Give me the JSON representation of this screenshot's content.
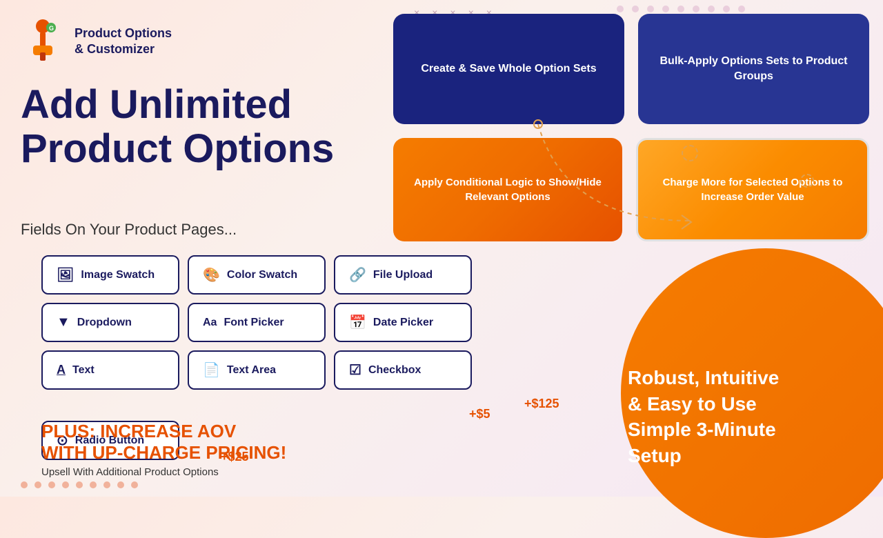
{
  "app": {
    "logo_line1": "Product Options",
    "logo_line2": "& Customizer"
  },
  "headline": {
    "line1": "Add Unlimited",
    "line2": "Product Options",
    "sub": "Fields On Your  Product Pages..."
  },
  "feature_cards": [
    {
      "id": "create-save",
      "text": "Create & Save Whole Option Sets",
      "style": "dark-blue"
    },
    {
      "id": "bulk-apply",
      "text": "Bulk-Apply Options Sets to Product Groups",
      "style": "navy"
    },
    {
      "id": "conditional",
      "text": "Apply Conditional Logic to Show/Hide Relevant Options",
      "style": "orange"
    },
    {
      "id": "charge-more",
      "text": "Charge More for Selected Options to Increase Order Value",
      "style": "outlined-orange"
    }
  ],
  "option_buttons": [
    {
      "id": "image-swatch",
      "icon": "🖼",
      "label": "Image Swatch"
    },
    {
      "id": "color-swatch",
      "icon": "🎨",
      "label": "Color Swatch"
    },
    {
      "id": "file-upload",
      "icon": "🔗",
      "label": "File Upload"
    },
    {
      "id": "dropdown",
      "icon": "▼",
      "label": "Dropdown"
    },
    {
      "id": "font-picker",
      "icon": "Aa",
      "label": "Font Picker"
    },
    {
      "id": "date-picker",
      "icon": "📅",
      "label": "Date Picker"
    },
    {
      "id": "text",
      "icon": "A",
      "label": "Text"
    },
    {
      "id": "text-area",
      "icon": "📄",
      "label": "Text Area"
    },
    {
      "id": "checkbox",
      "icon": "☑",
      "label": "Checkbox"
    },
    {
      "id": "radio-button",
      "icon": "⊙",
      "label": "Radio Button"
    }
  ],
  "aov": {
    "title_line1": "PLUS: INCREASE AOV",
    "title_line2": "WITH UP-CHARGE PRICING!",
    "subtitle": "Upsell With Additional Product Options"
  },
  "price_badges": [
    "+$5",
    "+$125",
    "+$25"
  ],
  "bottom_right": {
    "line1": "Robust, Intuitive",
    "line2": "& Easy to Use",
    "line3": "Simple 3-Minute",
    "line4": "Setup"
  },
  "crosses": [
    "×",
    "×",
    "×",
    "×",
    "×"
  ],
  "dots": [
    1,
    2,
    3,
    4,
    5,
    6,
    7,
    8,
    9
  ]
}
